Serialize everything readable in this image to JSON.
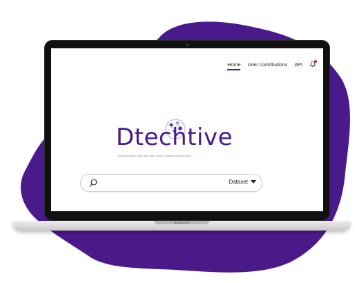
{
  "nav": {
    "items": [
      {
        "label": "Home",
        "active": true
      },
      {
        "label": "User contributions",
        "active": false
      },
      {
        "label": "API",
        "active": false
      }
    ],
    "notification_icon": "bell-icon",
    "notification_indicator_color": "#d93025"
  },
  "logo": {
    "text": "Dtechtive",
    "tagline": "Discovering the data that other search engines cannot reach."
  },
  "search": {
    "placeholder": "",
    "value": "",
    "category": "Dataset"
  },
  "device": {
    "label": "MacBook Air"
  },
  "colors": {
    "accent": "#4a1a8a",
    "blob": "#4a1a8a",
    "bezel": "#111111"
  }
}
